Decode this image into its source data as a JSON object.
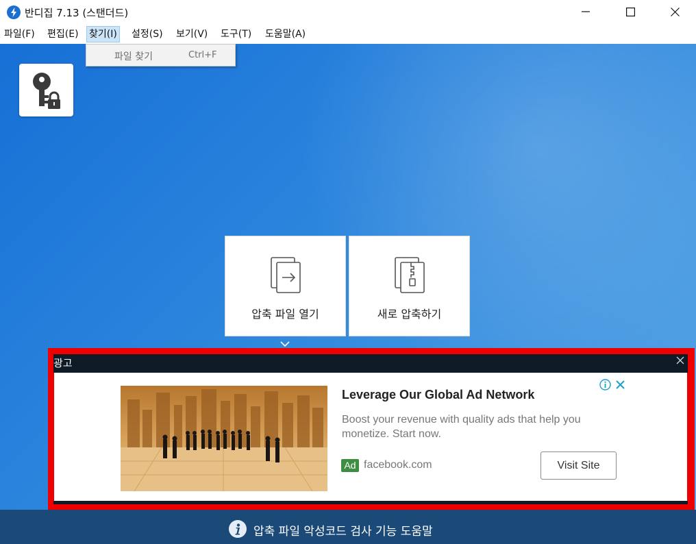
{
  "window": {
    "title": "반디집 7.13 (스탠더드)"
  },
  "menubar": {
    "items": [
      {
        "label": "파일(F)"
      },
      {
        "label": "편집(E)"
      },
      {
        "label": "찾기(I)"
      },
      {
        "label": "설정(S)"
      },
      {
        "label": "보기(V)"
      },
      {
        "label": "도구(T)"
      },
      {
        "label": "도움말(A)"
      }
    ],
    "active_index": 2
  },
  "dropdown": {
    "items": [
      {
        "label": "파일 찾기",
        "shortcut": "Ctrl+F"
      }
    ]
  },
  "main": {
    "tiles": [
      {
        "label": "압축 파일 열기",
        "icon": "open-archive-icon"
      },
      {
        "label": "새로 압축하기",
        "icon": "new-archive-icon"
      }
    ]
  },
  "ad": {
    "header_label": "광고",
    "title": "Leverage Our Global Ad Network",
    "description": "Boost your revenue with quality ads that help you monetize. Start now.",
    "badge": "Ad",
    "domain": "facebook.com",
    "cta": "Visit Site",
    "highlight_color": "#ee0000"
  },
  "status": {
    "text": "압축 파일 악성코드 검사 기능 도움말"
  },
  "colors": {
    "main_blue": "#1670d6",
    "status_bar": "#1c4a78",
    "ad_badge": "#3e8e41"
  }
}
